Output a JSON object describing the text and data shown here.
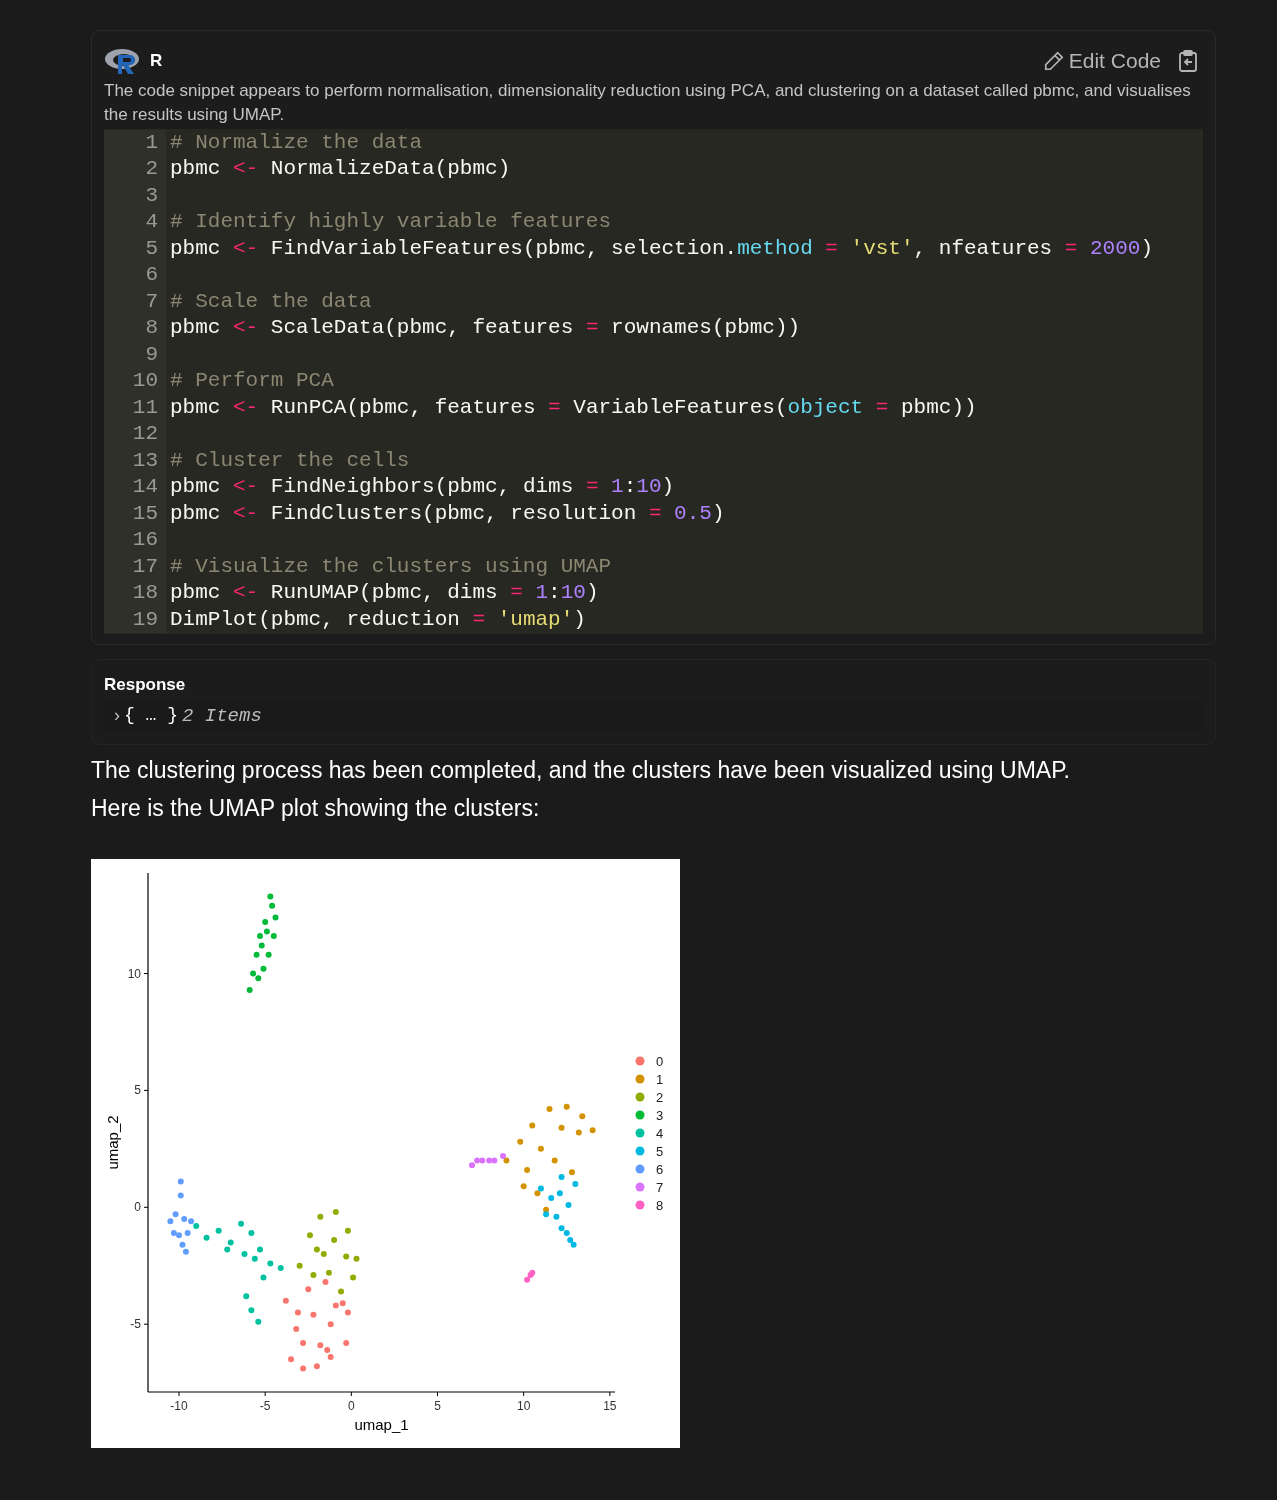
{
  "code_block": {
    "language": "R",
    "edit_button": "Edit Code",
    "description": "The code snippet appears to perform normalisation, dimensionality reduction using PCA, and clustering on a dataset called pbmc, and visualises the results using UMAP.",
    "lines": [
      {
        "number": "1",
        "tokens": [
          {
            "kind": "comment",
            "text": "# Normalize the data"
          }
        ]
      },
      {
        "number": "2",
        "tokens": [
          {
            "kind": "plain",
            "text": "pbmc "
          },
          {
            "kind": "op",
            "text": "<-"
          },
          {
            "kind": "plain",
            "text": " NormalizeData(pbmc)"
          }
        ]
      },
      {
        "number": "3"
      },
      {
        "number": "4",
        "tokens": [
          {
            "kind": "comment",
            "text": "# Identify highly variable features"
          }
        ]
      },
      {
        "number": "5",
        "tokens": [
          {
            "kind": "plain",
            "text": "pbmc "
          },
          {
            "kind": "op",
            "text": "<-"
          },
          {
            "kind": "plain",
            "text": " FindVariableFeatures(pbmc, selection."
          },
          {
            "kind": "attr",
            "text": "method"
          },
          {
            "kind": "op",
            "text": " = "
          },
          {
            "kind": "string",
            "text": "'vst'"
          },
          {
            "kind": "plain",
            "text": ", nfeatures"
          },
          {
            "kind": "op",
            "text": " = "
          },
          {
            "kind": "number",
            "text": "2000"
          },
          {
            "kind": "plain",
            "text": ")"
          }
        ]
      },
      {
        "number": "6"
      },
      {
        "number": "7",
        "tokens": [
          {
            "kind": "comment",
            "text": "# Scale the data"
          }
        ]
      },
      {
        "number": "8",
        "tokens": [
          {
            "kind": "plain",
            "text": "pbmc "
          },
          {
            "kind": "op",
            "text": "<-"
          },
          {
            "kind": "plain",
            "text": " ScaleData(pbmc, features"
          },
          {
            "kind": "op",
            "text": " = "
          },
          {
            "kind": "plain",
            "text": "rownames(pbmc))"
          }
        ]
      },
      {
        "number": "9"
      },
      {
        "number": "10",
        "tokens": [
          {
            "kind": "comment",
            "text": "# Perform PCA"
          }
        ]
      },
      {
        "number": "11",
        "tokens": [
          {
            "kind": "plain",
            "text": "pbmc "
          },
          {
            "kind": "op",
            "text": "<-"
          },
          {
            "kind": "plain",
            "text": " RunPCA(pbmc, features"
          },
          {
            "kind": "op",
            "text": " = "
          },
          {
            "kind": "plain",
            "text": "VariableFeatures("
          },
          {
            "kind": "attr",
            "text": "object"
          },
          {
            "kind": "op",
            "text": " = "
          },
          {
            "kind": "plain",
            "text": "pbmc))"
          }
        ]
      },
      {
        "number": "12"
      },
      {
        "number": "13",
        "tokens": [
          {
            "kind": "comment",
            "text": "# Cluster the cells"
          }
        ]
      },
      {
        "number": "14",
        "tokens": [
          {
            "kind": "plain",
            "text": "pbmc "
          },
          {
            "kind": "op",
            "text": "<-"
          },
          {
            "kind": "plain",
            "text": " FindNeighbors(pbmc, dims"
          },
          {
            "kind": "op",
            "text": " = "
          },
          {
            "kind": "number",
            "text": "1"
          },
          {
            "kind": "plain",
            "text": ":"
          },
          {
            "kind": "number",
            "text": "10"
          },
          {
            "kind": "plain",
            "text": ")"
          }
        ]
      },
      {
        "number": "15",
        "tokens": [
          {
            "kind": "plain",
            "text": "pbmc "
          },
          {
            "kind": "op",
            "text": "<-"
          },
          {
            "kind": "plain",
            "text": " FindClusters(pbmc, resolution"
          },
          {
            "kind": "op",
            "text": " = "
          },
          {
            "kind": "number",
            "text": "0.5"
          },
          {
            "kind": "plain",
            "text": ")"
          }
        ]
      },
      {
        "number": "16"
      },
      {
        "number": "17",
        "tokens": [
          {
            "kind": "comment",
            "text": "# Visualize the clusters using UMAP"
          }
        ]
      },
      {
        "number": "18",
        "tokens": [
          {
            "kind": "plain",
            "text": "pbmc "
          },
          {
            "kind": "op",
            "text": "<-"
          },
          {
            "kind": "plain",
            "text": " RunUMAP(pbmc, dims"
          },
          {
            "kind": "op",
            "text": " = "
          },
          {
            "kind": "number",
            "text": "1"
          },
          {
            "kind": "plain",
            "text": ":"
          },
          {
            "kind": "number",
            "text": "10"
          },
          {
            "kind": "plain",
            "text": ")"
          }
        ]
      },
      {
        "number": "19",
        "tokens": [
          {
            "kind": "plain",
            "text": "DimPlot(pbmc, reduction"
          },
          {
            "kind": "op",
            "text": " = "
          },
          {
            "kind": "string",
            "text": "'umap'"
          },
          {
            "kind": "plain",
            "text": ")"
          }
        ]
      }
    ]
  },
  "response": {
    "title": "Response",
    "toggle": "›",
    "summary": "{ … }",
    "count": "2 Items"
  },
  "message": [
    "The clustering process has been completed, and the clusters have been visualized using UMAP.",
    "Here is the UMAP plot showing the clusters:"
  ],
  "plot": {
    "chart_data": {
      "type": "scatter",
      "legend": "right",
      "xlabel": "umap_1",
      "ylabel": "umap_2",
      "xlim": [
        -11.8,
        15.3
      ],
      "ylim": [
        -7.9,
        14.3
      ],
      "xticks": [
        -10,
        -5,
        0,
        5,
        10,
        15
      ],
      "yticks": [
        -5,
        0,
        5,
        10
      ],
      "series": [
        {
          "name": "0",
          "color": "#f8766d",
          "x": [
            -3.8,
            -3.2,
            -3.5,
            -2.8,
            -2,
            -1.2,
            -0.3,
            -0.2,
            -0.5,
            -1.5,
            -2.5,
            -2.2,
            -1.2,
            -2.8,
            -1.8,
            -0.9,
            -3.1,
            -1.4
          ],
          "values": [
            -4,
            -5.2,
            -6.5,
            -6.9,
            -6.8,
            -6.4,
            -5.8,
            -4.5,
            -4.1,
            -3.2,
            -3.5,
            -4.6,
            -5,
            -5.8,
            -5.9,
            -4.2,
            -4.5,
            -6.1
          ]
        },
        {
          "name": "1",
          "color": "#d39200",
          "x": [
            9,
            9.8,
            10.5,
            11.5,
            12.5,
            13.4,
            14,
            13.2,
            12.2,
            11,
            10.2,
            10.8,
            11.3,
            12.8,
            11.8,
            10
          ],
          "values": [
            2,
            2.8,
            3.5,
            4.2,
            4.3,
            3.9,
            3.3,
            3.2,
            3.4,
            2.5,
            1.6,
            0.6,
            -0.1,
            1.5,
            2,
            0.9
          ]
        },
        {
          "name": "2",
          "color": "#93aa00",
          "x": [
            -3,
            -2.4,
            -1.8,
            -0.9,
            -0.2,
            0.3,
            0.1,
            -0.6,
            -1.6,
            -2.2,
            -1,
            -1.3,
            -0.3,
            -2
          ],
          "values": [
            -2.5,
            -1.2,
            -0.4,
            -0.2,
            -1,
            -2.2,
            -3,
            -3.6,
            -2,
            -2.9,
            -1.4,
            -2.8,
            -2.1,
            -1.8
          ]
        },
        {
          "name": "3",
          "color": "#00ba38",
          "x": [
            -5.9,
            -5.7,
            -5.5,
            -5.3,
            -5,
            -4.6,
            -4.4,
            -4.5,
            -4.8,
            -5.1,
            -5.2,
            -4.9,
            -5.4,
            -4.7
          ],
          "values": [
            9.3,
            10,
            10.8,
            11.6,
            12.2,
            12.9,
            12.4,
            11.6,
            10.8,
            10.2,
            11.2,
            11.8,
            9.8,
            13.3
          ]
        },
        {
          "name": "4",
          "color": "#00c19f",
          "x": [
            -9,
            -8.4,
            -7.7,
            -7,
            -6.4,
            -5.8,
            -5.3,
            -4.7,
            -5.1,
            -5.6,
            -6.2,
            -6.1,
            -5.8,
            -5.4,
            -7.2,
            -4.1
          ],
          "values": [
            -0.8,
            -1.3,
            -1,
            -1.5,
            -0.7,
            -1.1,
            -1.8,
            -2.4,
            -3,
            -2.2,
            -2,
            -3.8,
            -4.4,
            -4.9,
            -1.8,
            -2.6
          ]
        },
        {
          "name": "5",
          "color": "#00b9e3",
          "x": [
            11,
            12.2,
            13,
            12.6,
            11.9,
            11.6,
            12.2,
            12.7,
            12.9,
            11.3,
            12.5,
            12.1
          ],
          "values": [
            0.8,
            1.3,
            1,
            0.1,
            -0.4,
            0.4,
            -0.9,
            -1.4,
            -1.6,
            -0.3,
            -1.1,
            0.6
          ]
        },
        {
          "name": "6",
          "color": "#619cff",
          "x": [
            -9.9,
            -9.9,
            -10.5,
            -10.2,
            -9.7,
            -9.3,
            -10.3,
            -9.8,
            -9.6,
            -10,
            -9.5
          ],
          "values": [
            1.1,
            0.5,
            -0.6,
            -0.3,
            -0.5,
            -0.6,
            -1.1,
            -1.6,
            -1.9,
            -1.2,
            -1.1
          ]
        },
        {
          "name": "7",
          "color": "#db72fb",
          "x": [
            7,
            7.3,
            7.6,
            8,
            8.3,
            8.8
          ],
          "values": [
            1.8,
            2,
            2,
            2,
            2,
            2.2
          ]
        },
        {
          "name": "8",
          "color": "#ff61c3",
          "x": [
            10.2,
            10.4,
            10.5
          ],
          "values": [
            -3.1,
            -2.9,
            -2.8
          ]
        }
      ]
    }
  }
}
